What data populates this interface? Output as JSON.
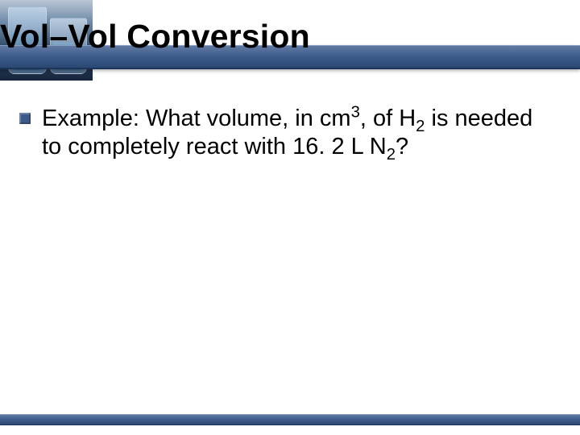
{
  "title": "Vol–Vol Conversion",
  "bullet": {
    "segments": {
      "s1": "Example: What volume, in cm",
      "sup3": "3",
      "s2": ", of H",
      "sub2a": "2",
      "s3": " is needed to completely react with 16. 2 L N",
      "sub2b": "2",
      "s4": "?"
    }
  }
}
